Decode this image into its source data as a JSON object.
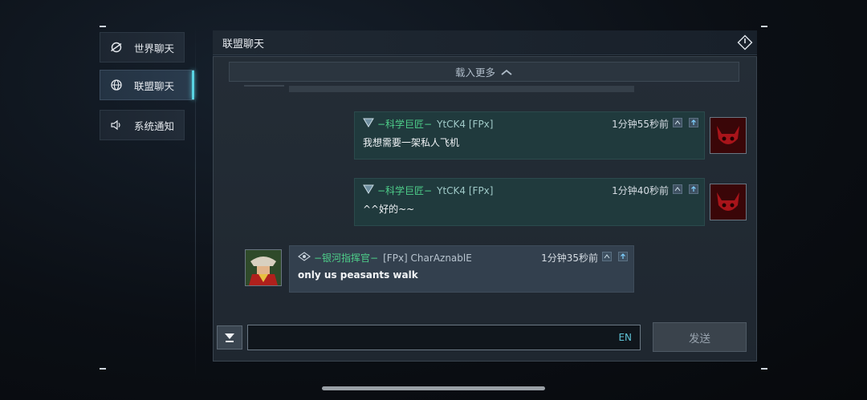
{
  "sidebar": {
    "items": [
      {
        "label": "世界聊天",
        "icon": "world-chat-icon",
        "active": false
      },
      {
        "label": "联盟聊天",
        "icon": "globe-icon",
        "active": true
      },
      {
        "label": "系统通知",
        "icon": "speaker-icon",
        "active": false
      }
    ]
  },
  "header": {
    "title": "联盟聊天",
    "exit_icon": "exit-icon"
  },
  "chat": {
    "load_more": "载入更多",
    "messages": [
      {
        "rank": "−科学巨匠−",
        "name": "YtCK4 [FPx]",
        "time": "1分钟55秒前",
        "text": "我想需要一架私人飞机",
        "side": "right",
        "avatar": "red-cat-avatar"
      },
      {
        "rank": "−科学巨匠−",
        "name": "YtCK4 [FPx]",
        "time": "1分钟40秒前",
        "text": "^^好的~~",
        "side": "right",
        "avatar": "red-cat-avatar"
      },
      {
        "rank": "−银河指挥官−",
        "name": "[FPx] CharAznablE",
        "time": "1分钟35秒前",
        "text": "only us peasants walk",
        "side": "left",
        "avatar": "commander-avatar"
      }
    ]
  },
  "composer": {
    "lang": "EN",
    "send_label": "发送",
    "value": ""
  },
  "colors": {
    "accent": "#59d3e2",
    "rank_green": "#4ecf8a",
    "mine_bubble": "#203a3d",
    "other_bubble": "#33404e"
  }
}
